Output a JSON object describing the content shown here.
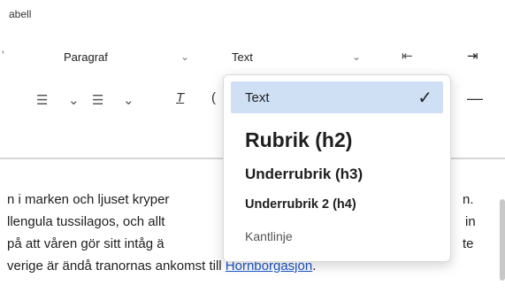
{
  "app": {
    "title_fragment": "abell"
  },
  "toolbar": {
    "paragraph_select": "Paragraf",
    "text_select": "Text",
    "icons": [
      "outdent-icon",
      "indent-icon",
      "numbered-list-icon",
      "chevron-down-icon",
      "bullet-list-icon",
      "chevron-down-icon",
      "clear-format-icon",
      "horizontal-rule-icon"
    ]
  },
  "style_menu": {
    "items": [
      {
        "label": "Text",
        "selected": true
      },
      {
        "label": "Rubrik (h2)"
      },
      {
        "label": "Underrubrik (h3)"
      },
      {
        "label": "Underrubrik 2 (h4)"
      },
      {
        "label": "Kantlinje"
      }
    ]
  },
  "content": {
    "line1_left": "n i marken och ljuset kryper",
    "line1_right": "n.",
    "line2_left": "llengula tussilagos, och allt",
    "line2_right": "in",
    "line3_left": "på att våren gör sitt intåg ä",
    "line3_right": "te",
    "line4_prefix": "verige är ändå tranornas ankomst till ",
    "line4_link": "Hornborgasjön",
    "line4_suffix": "."
  },
  "colors": {
    "selected_bg": "#cfe0f5",
    "link": "#1a55c9"
  }
}
